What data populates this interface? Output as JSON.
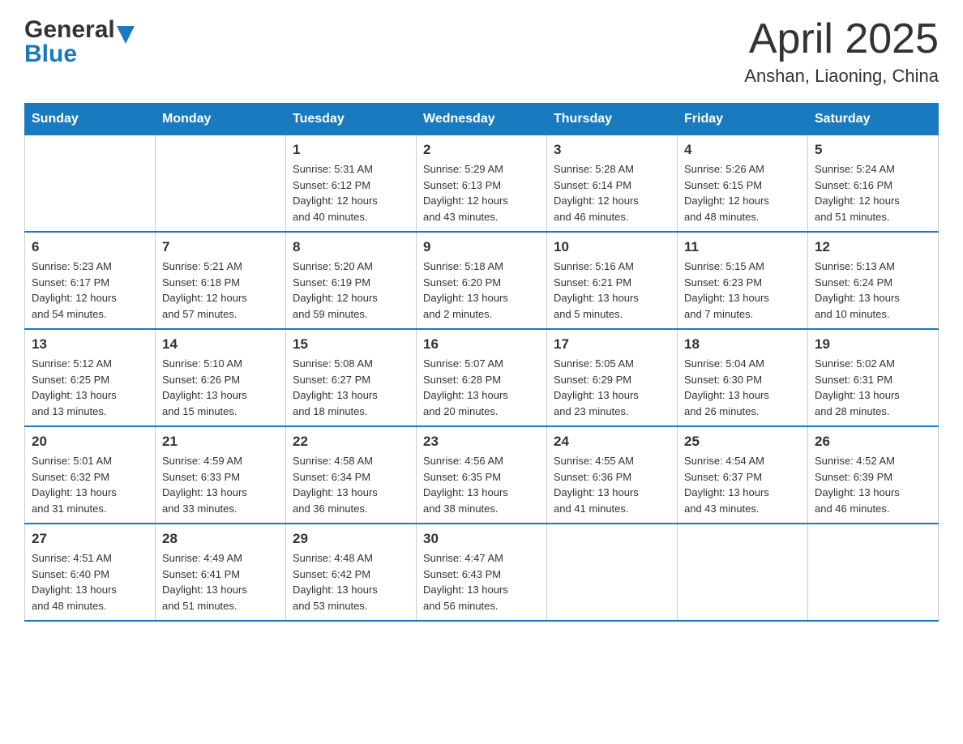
{
  "header": {
    "logo_general": "General",
    "logo_blue": "Blue",
    "title": "April 2025",
    "subtitle": "Anshan, Liaoning, China"
  },
  "weekdays": [
    "Sunday",
    "Monday",
    "Tuesday",
    "Wednesday",
    "Thursday",
    "Friday",
    "Saturday"
  ],
  "weeks": [
    [
      {
        "day": "",
        "info": ""
      },
      {
        "day": "",
        "info": ""
      },
      {
        "day": "1",
        "info": "Sunrise: 5:31 AM\nSunset: 6:12 PM\nDaylight: 12 hours\nand 40 minutes."
      },
      {
        "day": "2",
        "info": "Sunrise: 5:29 AM\nSunset: 6:13 PM\nDaylight: 12 hours\nand 43 minutes."
      },
      {
        "day": "3",
        "info": "Sunrise: 5:28 AM\nSunset: 6:14 PM\nDaylight: 12 hours\nand 46 minutes."
      },
      {
        "day": "4",
        "info": "Sunrise: 5:26 AM\nSunset: 6:15 PM\nDaylight: 12 hours\nand 48 minutes."
      },
      {
        "day": "5",
        "info": "Sunrise: 5:24 AM\nSunset: 6:16 PM\nDaylight: 12 hours\nand 51 minutes."
      }
    ],
    [
      {
        "day": "6",
        "info": "Sunrise: 5:23 AM\nSunset: 6:17 PM\nDaylight: 12 hours\nand 54 minutes."
      },
      {
        "day": "7",
        "info": "Sunrise: 5:21 AM\nSunset: 6:18 PM\nDaylight: 12 hours\nand 57 minutes."
      },
      {
        "day": "8",
        "info": "Sunrise: 5:20 AM\nSunset: 6:19 PM\nDaylight: 12 hours\nand 59 minutes."
      },
      {
        "day": "9",
        "info": "Sunrise: 5:18 AM\nSunset: 6:20 PM\nDaylight: 13 hours\nand 2 minutes."
      },
      {
        "day": "10",
        "info": "Sunrise: 5:16 AM\nSunset: 6:21 PM\nDaylight: 13 hours\nand 5 minutes."
      },
      {
        "day": "11",
        "info": "Sunrise: 5:15 AM\nSunset: 6:23 PM\nDaylight: 13 hours\nand 7 minutes."
      },
      {
        "day": "12",
        "info": "Sunrise: 5:13 AM\nSunset: 6:24 PM\nDaylight: 13 hours\nand 10 minutes."
      }
    ],
    [
      {
        "day": "13",
        "info": "Sunrise: 5:12 AM\nSunset: 6:25 PM\nDaylight: 13 hours\nand 13 minutes."
      },
      {
        "day": "14",
        "info": "Sunrise: 5:10 AM\nSunset: 6:26 PM\nDaylight: 13 hours\nand 15 minutes."
      },
      {
        "day": "15",
        "info": "Sunrise: 5:08 AM\nSunset: 6:27 PM\nDaylight: 13 hours\nand 18 minutes."
      },
      {
        "day": "16",
        "info": "Sunrise: 5:07 AM\nSunset: 6:28 PM\nDaylight: 13 hours\nand 20 minutes."
      },
      {
        "day": "17",
        "info": "Sunrise: 5:05 AM\nSunset: 6:29 PM\nDaylight: 13 hours\nand 23 minutes."
      },
      {
        "day": "18",
        "info": "Sunrise: 5:04 AM\nSunset: 6:30 PM\nDaylight: 13 hours\nand 26 minutes."
      },
      {
        "day": "19",
        "info": "Sunrise: 5:02 AM\nSunset: 6:31 PM\nDaylight: 13 hours\nand 28 minutes."
      }
    ],
    [
      {
        "day": "20",
        "info": "Sunrise: 5:01 AM\nSunset: 6:32 PM\nDaylight: 13 hours\nand 31 minutes."
      },
      {
        "day": "21",
        "info": "Sunrise: 4:59 AM\nSunset: 6:33 PM\nDaylight: 13 hours\nand 33 minutes."
      },
      {
        "day": "22",
        "info": "Sunrise: 4:58 AM\nSunset: 6:34 PM\nDaylight: 13 hours\nand 36 minutes."
      },
      {
        "day": "23",
        "info": "Sunrise: 4:56 AM\nSunset: 6:35 PM\nDaylight: 13 hours\nand 38 minutes."
      },
      {
        "day": "24",
        "info": "Sunrise: 4:55 AM\nSunset: 6:36 PM\nDaylight: 13 hours\nand 41 minutes."
      },
      {
        "day": "25",
        "info": "Sunrise: 4:54 AM\nSunset: 6:37 PM\nDaylight: 13 hours\nand 43 minutes."
      },
      {
        "day": "26",
        "info": "Sunrise: 4:52 AM\nSunset: 6:39 PM\nDaylight: 13 hours\nand 46 minutes."
      }
    ],
    [
      {
        "day": "27",
        "info": "Sunrise: 4:51 AM\nSunset: 6:40 PM\nDaylight: 13 hours\nand 48 minutes."
      },
      {
        "day": "28",
        "info": "Sunrise: 4:49 AM\nSunset: 6:41 PM\nDaylight: 13 hours\nand 51 minutes."
      },
      {
        "day": "29",
        "info": "Sunrise: 4:48 AM\nSunset: 6:42 PM\nDaylight: 13 hours\nand 53 minutes."
      },
      {
        "day": "30",
        "info": "Sunrise: 4:47 AM\nSunset: 6:43 PM\nDaylight: 13 hours\nand 56 minutes."
      },
      {
        "day": "",
        "info": ""
      },
      {
        "day": "",
        "info": ""
      },
      {
        "day": "",
        "info": ""
      }
    ]
  ]
}
